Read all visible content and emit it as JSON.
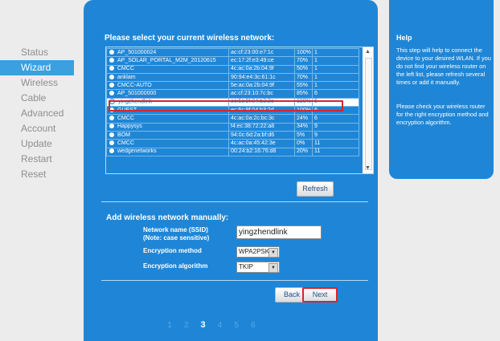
{
  "nav": {
    "items": [
      {
        "label": "Status",
        "active": false
      },
      {
        "label": "Wizard",
        "active": true
      },
      {
        "label": "Wireless",
        "active": false
      },
      {
        "label": "Cable",
        "active": false
      },
      {
        "label": "Advanced",
        "active": false
      },
      {
        "label": "Account",
        "active": false
      },
      {
        "label": "Update",
        "active": false
      },
      {
        "label": "Restart",
        "active": false
      },
      {
        "label": "Reset",
        "active": false
      }
    ]
  },
  "wizard": {
    "select_title": "Please select your current wireless network:",
    "networks": [
      {
        "ssid": "AP_501000024",
        "mac": "ac:cf:23:00:e7:1c",
        "signal": "100%",
        "channel": "1"
      },
      {
        "ssid": "AP_SOLAR_PORTAL_M2M_20120615",
        "mac": "ec:17:2f:e3:49:ce",
        "signal": "70%",
        "channel": "1"
      },
      {
        "ssid": "CMCC",
        "mac": "4c:ac:0a:2b:04:9f",
        "signal": "50%",
        "channel": "1"
      },
      {
        "ssid": "anklam",
        "mac": "90:94:e4:3c:61:1c",
        "signal": "70%",
        "channel": "1"
      },
      {
        "ssid": "CMCC-AUTO",
        "mac": "5e:ac:0a:2b:04:9f",
        "signal": "55%",
        "channel": "1"
      },
      {
        "ssid": "AP_501000000",
        "mac": "ac:cf:23:10:7c:bc",
        "signal": "85%",
        "channel": "6"
      },
      {
        "ssid": "yingzhendlink",
        "mac": "ec:6c:9f:04:b3:2c",
        "signal": "100%",
        "channel": "6"
      },
      {
        "ssid": "GUEST",
        "mac": "ec:6c:9f:04:b3:2d",
        "signal": "100%",
        "channel": "6"
      },
      {
        "ssid": "CMCC",
        "mac": "4c:ac:0a:2c:bc:3c",
        "signal": "24%",
        "channel": "6"
      },
      {
        "ssid": "Happysys",
        "mac": "f4:ec:38:72:22:a8",
        "signal": "34%",
        "channel": "9"
      },
      {
        "ssid": "BOM",
        "mac": "94:0c:6d:2a:bf:d6",
        "signal": "5%",
        "channel": "9"
      },
      {
        "ssid": "CMCC",
        "mac": "4c:ac:0a:45:42:3e",
        "signal": "0%",
        "channel": "11"
      },
      {
        "ssid": "wedgenetworks",
        "mac": "00:24:b2:16:76:d8",
        "signal": "20%",
        "channel": "11"
      }
    ],
    "selected_index": 6,
    "refresh_label": "Refresh",
    "add_title": "Add wireless network manually:",
    "ssid_label": "Network name (SSID)",
    "ssid_note": "(Note: case sensitive)",
    "ssid_value": "yingzhendlink",
    "enc_method_label": "Encryption method",
    "enc_method_value": "WPA2PSK",
    "enc_algo_label": "Encryption algorithm",
    "enc_algo_value": "TKIP",
    "back_label": "Back",
    "next_label": "Next",
    "steps": [
      "1",
      "2",
      "3",
      "4",
      "5",
      "6"
    ],
    "current_step": "3"
  },
  "help": {
    "title": "Help",
    "p1": "This step will help to connect the device to your desired WLAN. If you do not find your wireless router on the left list, please refresh several times or add it manually.",
    "p2": "Please check your wireless router for the right encryption method and encryption algorithm."
  },
  "colors": {
    "accent": "#1f86d7",
    "highlight": "#d6262b"
  }
}
